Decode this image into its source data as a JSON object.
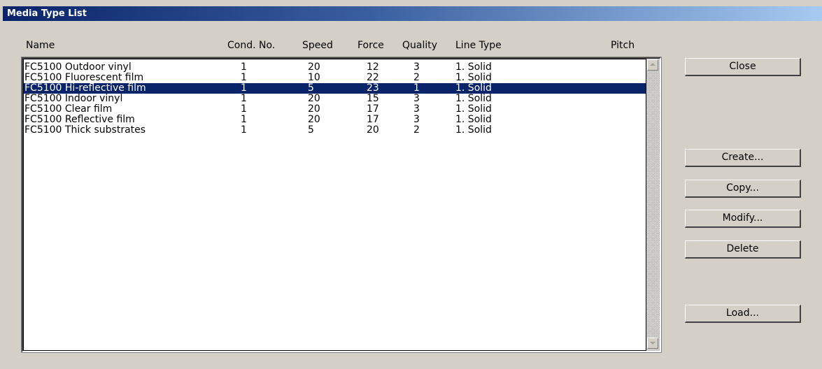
{
  "window": {
    "title": "Media Type List"
  },
  "columns": {
    "name": "Name",
    "cond": "Cond. No.",
    "speed": "Speed",
    "force": "Force",
    "quality": "Quality",
    "line_type": "Line Type",
    "pitch": "Pitch"
  },
  "rows": [
    {
      "name": "FC5100 Outdoor vinyl",
      "cond": "1",
      "speed": "20",
      "force": "12",
      "quality": "3",
      "line_type": "1. Solid",
      "pitch": "",
      "selected": false
    },
    {
      "name": "FC5100 Fluorescent film",
      "cond": "1",
      "speed": "10",
      "force": "22",
      "quality": "2",
      "line_type": "1. Solid",
      "pitch": "",
      "selected": false
    },
    {
      "name": "FC5100 Hi-reflective film",
      "cond": "1",
      "speed": "5",
      "force": "23",
      "quality": "1",
      "line_type": "1. Solid",
      "pitch": "",
      "selected": true
    },
    {
      "name": "FC5100 Indoor vinyl",
      "cond": "1",
      "speed": "20",
      "force": "15",
      "quality": "3",
      "line_type": "1. Solid",
      "pitch": "",
      "selected": false
    },
    {
      "name": "FC5100 Clear film",
      "cond": "1",
      "speed": "20",
      "force": "17",
      "quality": "3",
      "line_type": "1. Solid",
      "pitch": "",
      "selected": false
    },
    {
      "name": "FC5100 Reflective film",
      "cond": "1",
      "speed": "20",
      "force": "17",
      "quality": "3",
      "line_type": "1. Solid",
      "pitch": "",
      "selected": false
    },
    {
      "name": "FC5100 Thick substrates",
      "cond": "1",
      "speed": "5",
      "force": "20",
      "quality": "2",
      "line_type": "1. Solid",
      "pitch": "",
      "selected": false
    }
  ],
  "buttons": {
    "close": "Close",
    "create": "Create...",
    "copy": "Copy...",
    "modify": "Modify...",
    "delete": "Delete",
    "load": "Load..."
  },
  "icons": {
    "scroll_up": "scroll-up-arrow-icon",
    "scroll_down": "scroll-down-arrow-icon"
  },
  "colors": {
    "title_gradient_start": "#0a246a",
    "title_gradient_end": "#a6caf0",
    "selection_bg": "#0a246a",
    "selection_fg": "#ffffff",
    "window_bg": "#d4d0c8"
  }
}
